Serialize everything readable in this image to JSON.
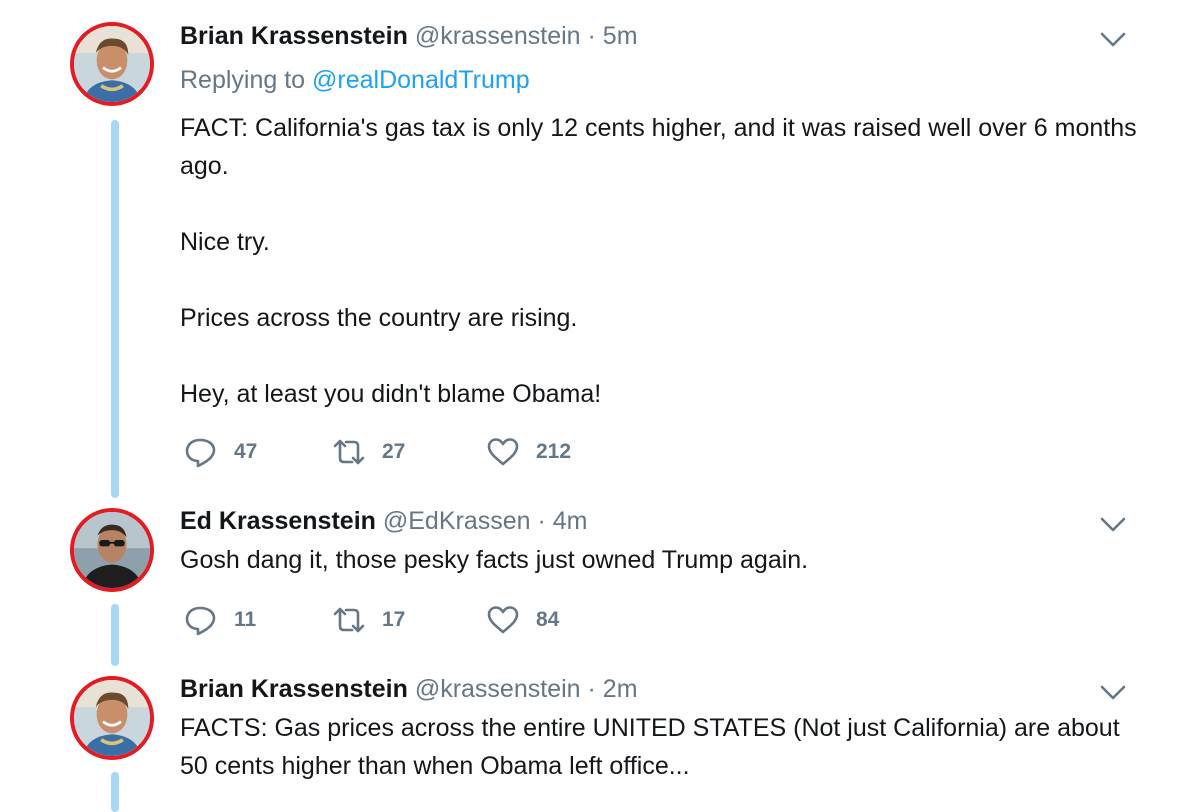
{
  "tweets": [
    {
      "name": "Brian Krassenstein",
      "handle": "@krassenstein",
      "separator": "·",
      "time": "5m",
      "replying_label": "Replying to",
      "replying_to": "@realDonaldTrump",
      "paragraphs": [
        "FACT:  California's gas tax is only 12 cents higher, and it was raised well over 6 months ago.",
        "Nice try.",
        "Prices across the country are rising.",
        "Hey, at least you didn't blame Obama!"
      ],
      "replies": "47",
      "retweets": "27",
      "likes": "212",
      "avatar_icon": "man-smiling-avatar"
    },
    {
      "name": "Ed Krassenstein",
      "handle": "@EdKrassen",
      "separator": "·",
      "time": "4m",
      "paragraphs": [
        "Gosh dang it, those pesky facts just owned Trump again."
      ],
      "replies": "11",
      "retweets": "17",
      "likes": "84",
      "avatar_icon": "man-sunglasses-avatar"
    },
    {
      "name": "Brian Krassenstein",
      "handle": "@krassenstein",
      "separator": "·",
      "time": "2m",
      "paragraphs": [
        "FACTS:  Gas prices across the entire UNITED STATES (Not just California) are about 50 cents higher than when Obama left office..."
      ],
      "avatar_icon": "man-smiling-avatar"
    }
  ],
  "icons": {
    "reply": "reply-bubble-icon",
    "retweet": "retweet-icon",
    "like": "heart-icon",
    "more": "chevron-down-icon"
  },
  "colors": {
    "text": "#14171a",
    "secondary": "#657786",
    "link": "#1da1f2",
    "thread_line": "#a7d7f3",
    "avatar_ring": "#e31b23"
  }
}
